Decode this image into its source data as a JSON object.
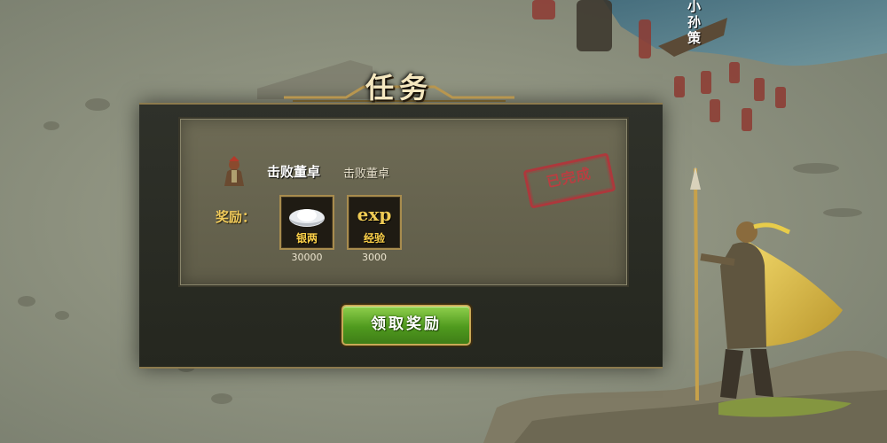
{
  "dialog": {
    "title": "任务",
    "task": {
      "icon": "warrior-avatar-icon",
      "name": "击败董卓",
      "description": "击败董卓",
      "status_stamp": "已完成"
    },
    "rewards_label": "奖励：",
    "rewards": [
      {
        "icon": "silver-ingot-icon",
        "label": "银两",
        "amount": "30000"
      },
      {
        "icon": "exp-icon",
        "label": "经验",
        "amount": "3000",
        "icon_text": "exp"
      }
    ],
    "claim_button": "领取奖励"
  },
  "scene": {
    "boat_label": "小孙策",
    "colors": {
      "accent_gold": "#c9a957",
      "button_green": "#5aa828",
      "stamp_red": "#b5343a"
    }
  }
}
